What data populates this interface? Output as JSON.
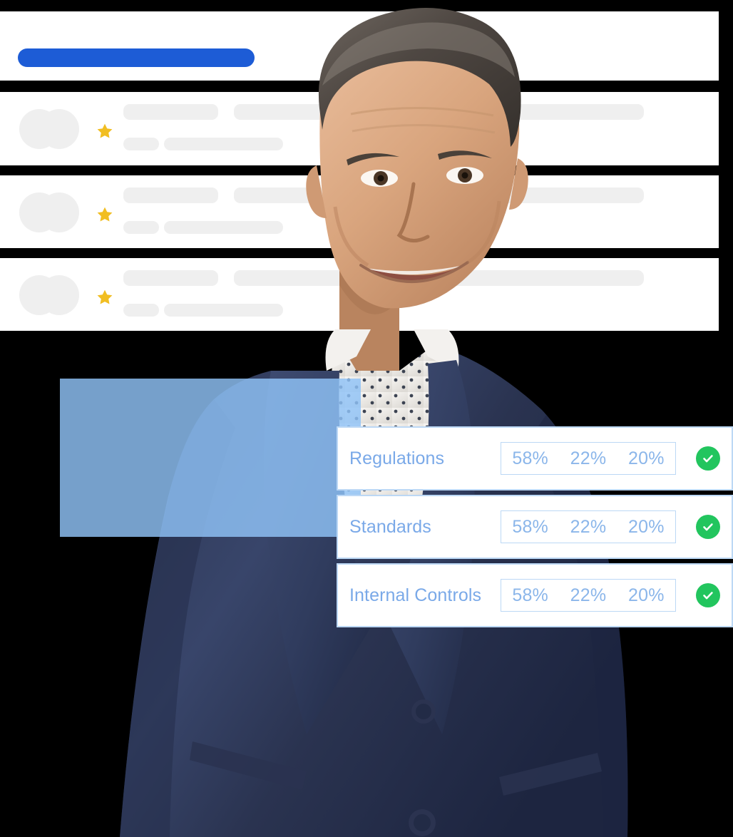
{
  "theme": {
    "background": "#000000",
    "card_background": "#ffffff",
    "accent_blue": "#1d5cd6",
    "overlay_blue": "#90c3f8",
    "label_blue": "#7aa9e8",
    "value_blue": "#8bb6ea",
    "border_blue": "#bcd8f5",
    "skeleton_gray": "#efefef",
    "star_yellow": "#f1be22",
    "status_green": "#22c55e"
  },
  "skeleton_panel": {
    "header": {
      "progress_bar_name": "blue-pill-bar"
    },
    "rows": [
      {
        "star_icon": "star-icon",
        "avatar_icons": [
          "avatar-circle",
          "avatar-circle"
        ],
        "placeholder_bars": [
          "line-1-short",
          "line-1-long",
          "line-2-short",
          "line-2-medium"
        ]
      },
      {
        "star_icon": "star-icon",
        "avatar_icons": [
          "avatar-circle",
          "avatar-circle"
        ],
        "placeholder_bars": [
          "line-1-short",
          "line-1-long",
          "line-2-short",
          "line-2-medium"
        ]
      },
      {
        "star_icon": "star-icon",
        "avatar_icons": [
          "avatar-circle",
          "avatar-circle"
        ],
        "placeholder_bars": [
          "line-1-short",
          "line-1-long",
          "line-2-short",
          "line-2-medium"
        ]
      }
    ]
  },
  "metric_cards": [
    {
      "label": "Regulations",
      "values": [
        "58%",
        "22%",
        "20%"
      ],
      "status_icon": "check-circle-icon"
    },
    {
      "label": "Standards",
      "values": [
        "58%",
        "22%",
        "20%"
      ],
      "status_icon": "check-circle-icon"
    },
    {
      "label": "Internal Controls",
      "values": [
        "58%",
        "22%",
        "20%"
      ],
      "status_icon": "check-circle-icon"
    }
  ],
  "decorations": {
    "blue_rectangle_name": "blue-accent-rectangle",
    "portrait_name": "businessman-portrait"
  }
}
